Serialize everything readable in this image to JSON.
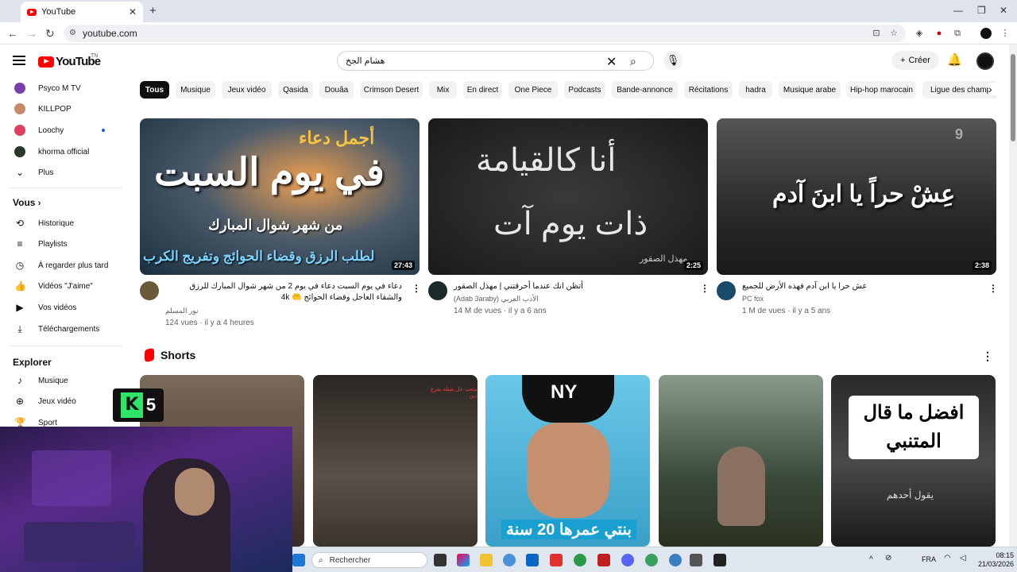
{
  "browser": {
    "tab_title": "YouTube",
    "url": "youtube.com"
  },
  "header": {
    "logo_text": "YouTube",
    "country_code": "TN",
    "search_query": "هشام الجخ",
    "create_label": "Créer"
  },
  "sidebar": {
    "subscriptions": [
      {
        "label": "Psyco M TV",
        "color": "#7a3ea8"
      },
      {
        "label": "KILLPOP",
        "color": "#c48a6a"
      },
      {
        "label": "Loochy",
        "color": "#e04060",
        "new": true
      },
      {
        "label": "khorma official",
        "color": "#2a3a2a"
      }
    ],
    "more_label": "Plus",
    "you_heading": "Vous",
    "you_items": [
      {
        "label": "Historique",
        "icon": "history-icon"
      },
      {
        "label": "Playlists",
        "icon": "playlists-icon"
      },
      {
        "label": "À regarder plus tard",
        "icon": "watch-later-icon"
      },
      {
        "label": "Vidéos \"J'aime\"",
        "icon": "like-icon"
      },
      {
        "label": "Vos vidéos",
        "icon": "your-videos-icon"
      },
      {
        "label": "Téléchargements",
        "icon": "download-icon"
      }
    ],
    "explore_heading": "Explorer",
    "explore_items": [
      {
        "label": "Musique",
        "icon": "music-icon"
      },
      {
        "label": "Jeux vidéo",
        "icon": "gaming-icon"
      },
      {
        "label": "Sport",
        "icon": "sport-icon"
      }
    ]
  },
  "chips": [
    "Tous",
    "Musique",
    "Jeux vidéo",
    "Qasida",
    "Douâa",
    "Crimson Desert",
    "Mix",
    "En direct",
    "One Piece",
    "Podcasts",
    "Bande-annonce",
    "Récitations",
    "hadra",
    "Musique arabe",
    "Hip-hop marocain",
    "Ligue des champions"
  ],
  "videos": [
    {
      "title": "دعاء في يوم السبت دعاء في يوم 2 من شهر شوال المبارك للرزق والشفاء العاجل وقضاء الحوائج 🤲 4k",
      "thumb_line1": "أجمل دعاء",
      "thumb_line2": "في يوم السبت",
      "thumb_line3": "من شهر شوال المبارك",
      "thumb_line4": "لطلب الرزق وقضاء الحوائج وتفريج الكرب",
      "channel": "نور المسلم",
      "meta": "124 vues · il y a 4 heures",
      "duration": "27:43"
    },
    {
      "title": "أتظن انك عندما أحرقتني | مهذل الصقور",
      "thumb_line1": "أنا كالقيامة",
      "thumb_line2": "ذات يوم آت",
      "thumb_line3": "مهذل الصقور",
      "channel": "(Adab 3araby) الأدب العربي",
      "meta": "14 M de vues · il y a 6 ans",
      "duration": "2:25"
    },
    {
      "title": "عش حرا يا ابن آدم فهذه الأرض للجميع",
      "thumb_line1": "عِشْ حراً يا ابنَ آدم",
      "thumb_line2": "9",
      "channel": "PC fox",
      "meta": "1 M de vues · il y a 5 ans",
      "duration": "2:38"
    }
  ],
  "shorts": {
    "heading": "Shorts",
    "items": [
      {
        "caption": ""
      },
      {
        "caption": "متعب خل شبله يفرغ دين"
      },
      {
        "caption": "بنتي عمرها 20 سنة",
        "logo": "NY"
      },
      {
        "caption": ""
      },
      {
        "caption": "افضل ما قال المتنبي",
        "sub": "يقول أحدهم"
      }
    ]
  },
  "overlay": {
    "badge_number": "5"
  },
  "taskbar": {
    "search_placeholder": "Rechercher",
    "lang": "FRA",
    "time": "08:15",
    "date": "21/03/2026"
  }
}
